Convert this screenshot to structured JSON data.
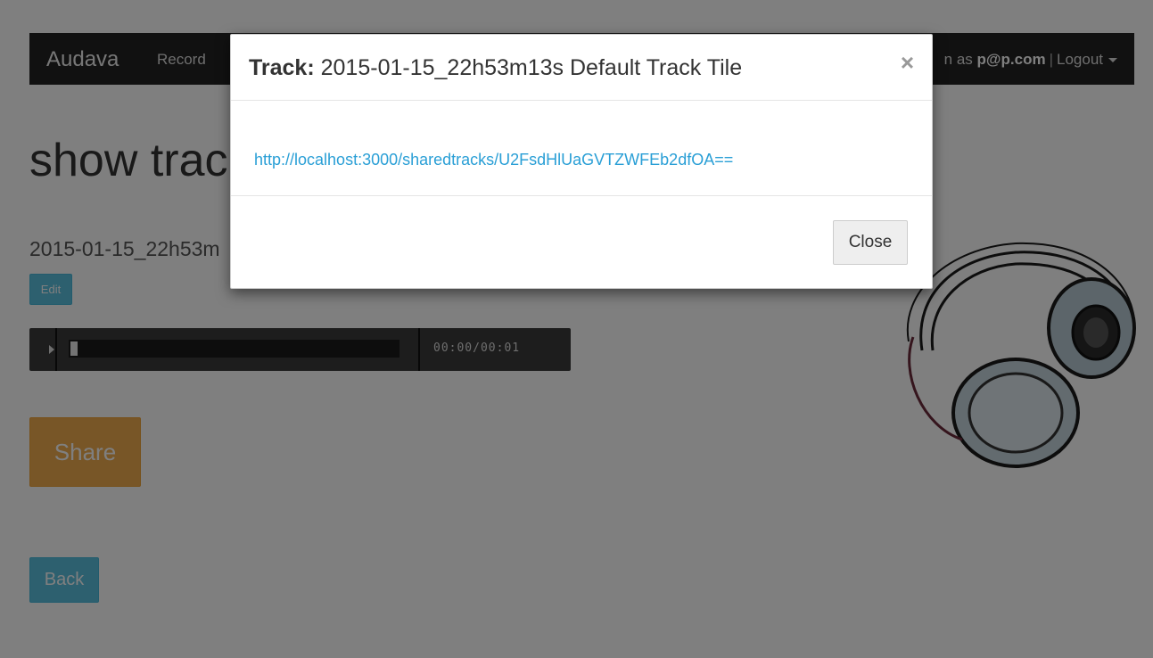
{
  "navbar": {
    "brand": "Audava",
    "record_link": "Record",
    "signed_in_prefix": "n as",
    "user": "p@p.com",
    "separator": "|",
    "logout": "Logout"
  },
  "page": {
    "title": "show trac",
    "track_name": "2015-01-15_22h53m",
    "edit_label": "Edit",
    "share_label": "Share",
    "back_label": "Back"
  },
  "player": {
    "time": "00:00/00:01",
    "progress": 0
  },
  "modal": {
    "title_label": "Track:",
    "title_value": "2015-01-15_22h53m13s Default Track Tile",
    "close_x": "×",
    "share_url": "http://localhost:3000/sharedtracks/U2FsdHlUaGVTZWFEb2dfOA==",
    "close_button": "Close"
  },
  "icons": {
    "play": "play-icon",
    "caret": "caret-down-icon",
    "headphones": "headphones-icon"
  },
  "colors": {
    "navbar": "#222222",
    "info": "#5bc0de",
    "warning": "#f0ad4e",
    "link": "#2a9fd6"
  }
}
